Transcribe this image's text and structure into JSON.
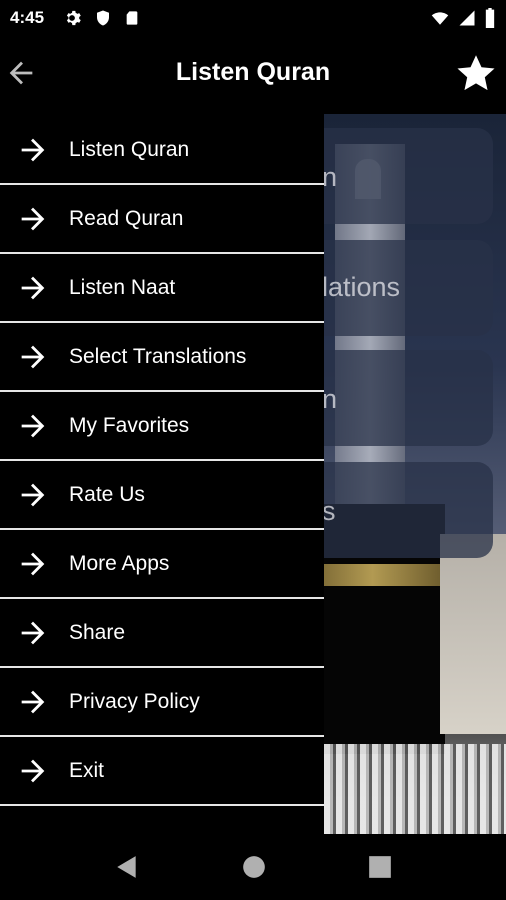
{
  "status": {
    "time": "4:45",
    "left_icons": [
      "gear-icon",
      "shield-icon",
      "sd-card-icon"
    ],
    "right_icons": [
      "wifi-icon",
      "signal-icon",
      "battery-icon"
    ]
  },
  "appbar": {
    "title": "Listen Quran",
    "back_icon": "arrow-back-icon",
    "favorite_icon": "star-icon"
  },
  "drawer": {
    "items": [
      {
        "label": "Listen Quran"
      },
      {
        "label": "Read Quran"
      },
      {
        "label": "Listen Naat"
      },
      {
        "label": "Select Translations"
      },
      {
        "label": "My Favorites"
      },
      {
        "label": "Rate Us"
      },
      {
        "label": "More Apps"
      },
      {
        "label": "Share"
      },
      {
        "label": "Privacy Policy"
      },
      {
        "label": "Exit"
      }
    ]
  },
  "background": {
    "cards": [
      {
        "visible_text": "n"
      },
      {
        "visible_text": "lations"
      },
      {
        "visible_text": "n"
      },
      {
        "visible_text": "s"
      }
    ]
  },
  "navbar": {
    "icons": [
      "back-triangle-icon",
      "home-circle-icon",
      "recents-square-icon"
    ]
  }
}
